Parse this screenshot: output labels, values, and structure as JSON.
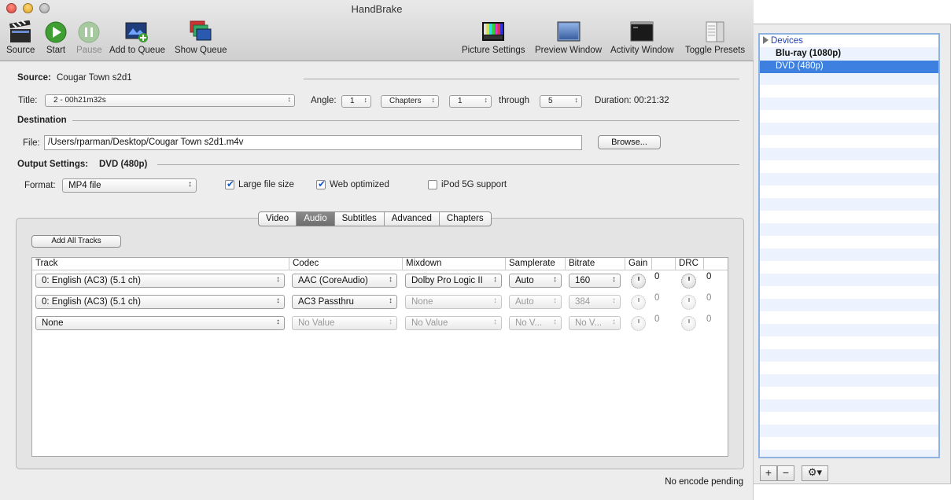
{
  "window": {
    "title": "HandBrake"
  },
  "toolbar": {
    "source": "Source",
    "start": "Start",
    "pause": "Pause",
    "add_to_queue": "Add to Queue",
    "show_queue": "Show Queue",
    "picture_settings": "Picture Settings",
    "preview_window": "Preview Window",
    "activity_window": "Activity Window",
    "toggle_presets": "Toggle Presets"
  },
  "source": {
    "label": "Source:",
    "value": "Cougar Town s2d1"
  },
  "title_row": {
    "title_label": "Title:",
    "title_value": "2 - 00h21m32s",
    "angle_label": "Angle:",
    "angle_value": "1",
    "range_type": "Chapters",
    "from": "1",
    "through_label": "through",
    "to": "5",
    "duration": "Duration: 00:21:32"
  },
  "destination": {
    "label": "Destination",
    "file_label": "File:",
    "file_value": "/Users/rparman/Desktop/Cougar Town s2d1.m4v",
    "browse": "Browse..."
  },
  "output": {
    "label": "Output Settings:",
    "preset": "DVD (480p)",
    "format_label": "Format:",
    "format_value": "MP4 file",
    "large_file": "Large file size",
    "web_optimized": "Web optimized",
    "ipod": "iPod 5G support"
  },
  "tabs": [
    "Video",
    "Audio",
    "Subtitles",
    "Advanced",
    "Chapters"
  ],
  "audio": {
    "add_all": "Add All Tracks",
    "headers": [
      "Track",
      "Codec",
      "Mixdown",
      "Samplerate",
      "Bitrate",
      "Gain",
      "DRC"
    ],
    "rows": [
      {
        "track": "0: English (AC3) (5.1 ch)",
        "codec": "AAC (CoreAudio)",
        "mixdown": "Dolby Pro Logic II",
        "samplerate": "Auto",
        "bitrate": "160",
        "gain": "0",
        "drc": "0"
      },
      {
        "track": "0: English (AC3) (5.1 ch)",
        "codec": "AC3 Passthru",
        "mixdown": "None",
        "samplerate": "Auto",
        "bitrate": "384",
        "gain": "0",
        "drc": "0"
      },
      {
        "track": "None",
        "codec": "No Value",
        "mixdown": "No Value",
        "samplerate": "No V...",
        "bitrate": "No V...",
        "gain": "0",
        "drc": "0"
      }
    ]
  },
  "status": "No encode pending",
  "presets": {
    "group": "Devices",
    "items": [
      "Blu-ray (1080p)",
      "DVD (480p)"
    ]
  },
  "presets_buttons": {
    "add": "+",
    "remove": "−",
    "gear": "⚙▾"
  }
}
